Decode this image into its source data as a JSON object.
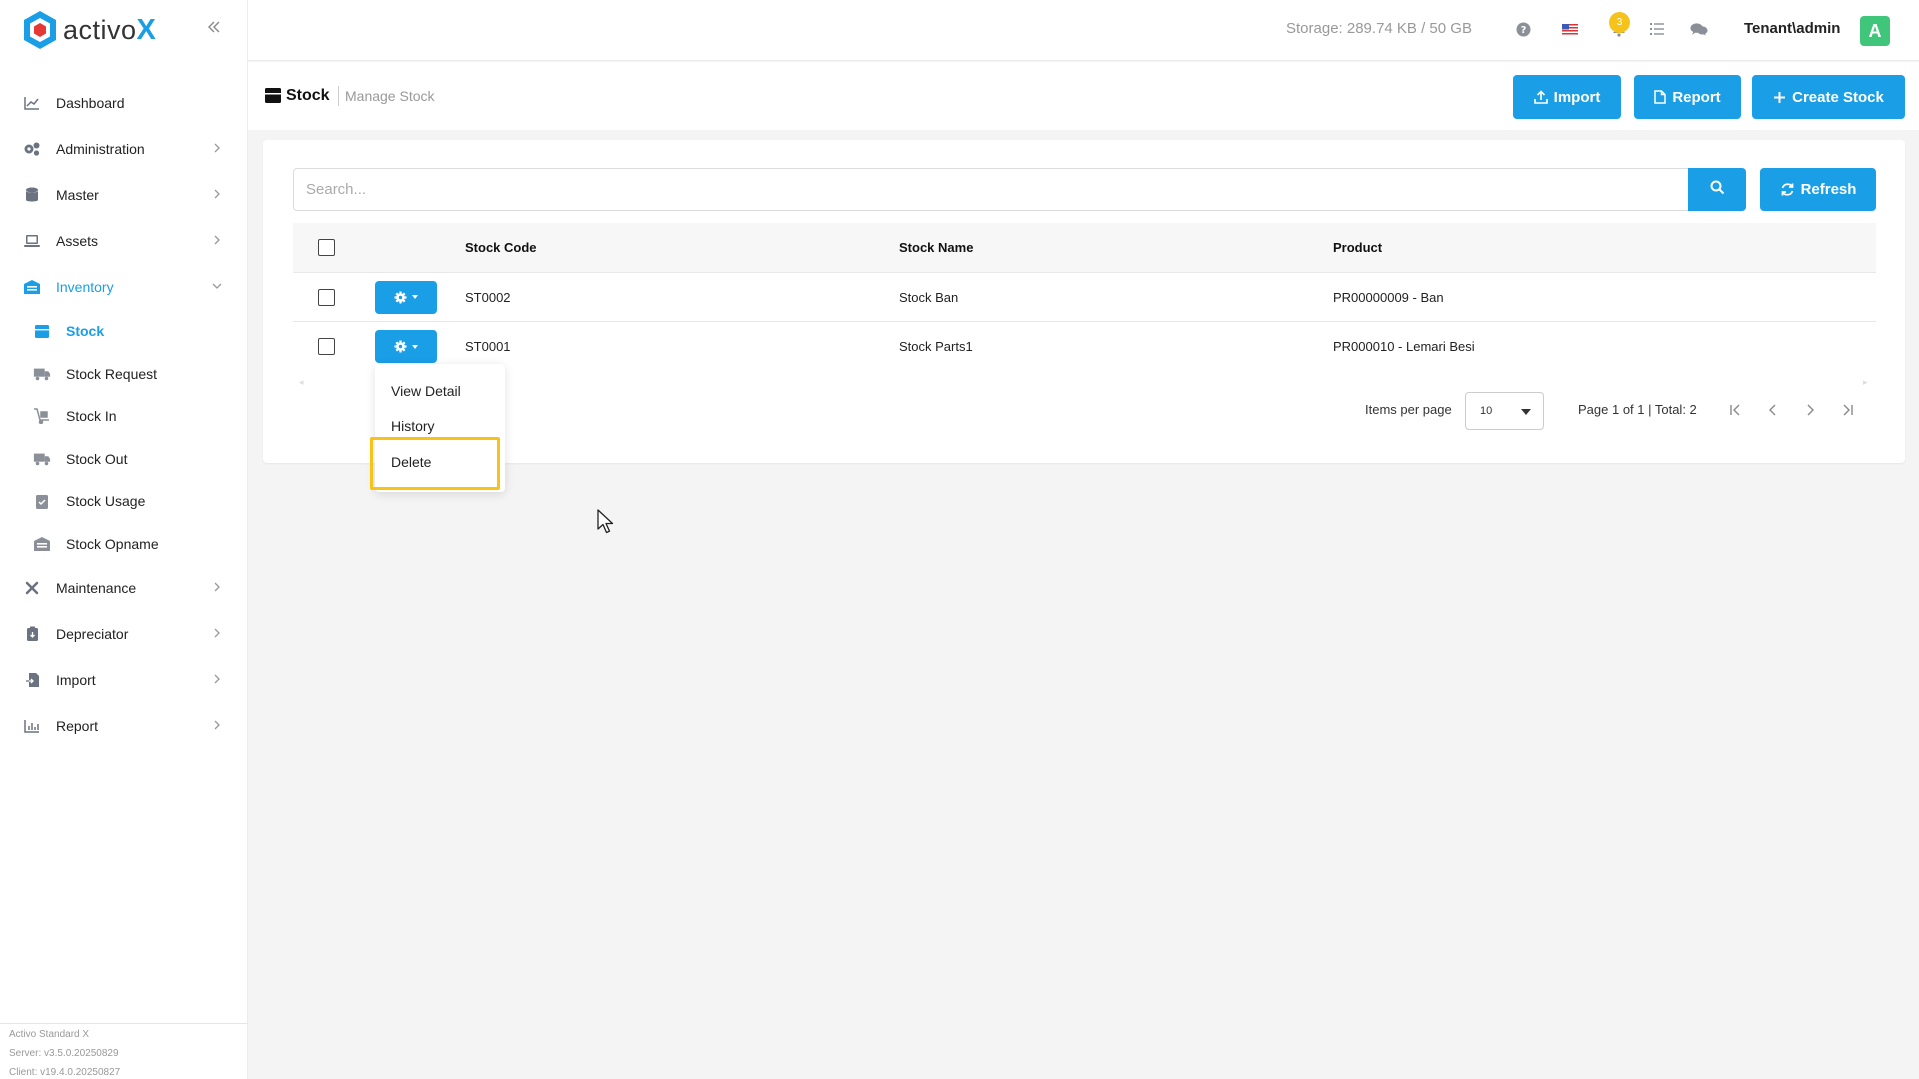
{
  "app": {
    "logo_text": "activo",
    "logo_x": "X"
  },
  "sidebar": {
    "items": [
      {
        "label": "Dashboard",
        "icon": "chart-line-icon",
        "has_chevron": false
      },
      {
        "label": "Administration",
        "icon": "gears-icon",
        "has_chevron": true
      },
      {
        "label": "Master",
        "icon": "database-icon",
        "has_chevron": true
      },
      {
        "label": "Assets",
        "icon": "laptop-icon",
        "has_chevron": true
      },
      {
        "label": "Inventory",
        "icon": "warehouse-icon",
        "has_chevron": true,
        "expanded": true
      }
    ],
    "inventory_sub": [
      {
        "label": "Stock",
        "icon": "box-icon",
        "active": true
      },
      {
        "label": "Stock Request",
        "icon": "truck-icon"
      },
      {
        "label": "Stock In",
        "icon": "dolly-icon"
      },
      {
        "label": "Stock Out",
        "icon": "truck-fast-icon"
      },
      {
        "label": "Stock Usage",
        "icon": "clipboard-check-icon"
      },
      {
        "label": "Stock Opname",
        "icon": "warehouse-icon"
      }
    ],
    "items_after": [
      {
        "label": "Maintenance",
        "icon": "tools-icon"
      },
      {
        "label": "Depreciator",
        "icon": "clipboard-down-icon"
      },
      {
        "label": "Import",
        "icon": "file-import-icon"
      },
      {
        "label": "Report",
        "icon": "chart-bar-icon"
      }
    ],
    "version": {
      "product": "Activo Standard X",
      "server": "Server: v3.5.0.20250829",
      "client": "Client: v19.4.0.20250827"
    }
  },
  "topbar": {
    "storage": "Storage: 289.74 KB / 50 GB",
    "notification_count": "3",
    "user": "Tenant\\admin",
    "avatar_letter": "A"
  },
  "page": {
    "title": "Stock",
    "subtitle": "Manage Stock",
    "buttons": {
      "import": "Import",
      "report": "Report",
      "create": "Create Stock"
    }
  },
  "search": {
    "placeholder": "Search...",
    "refresh": "Refresh"
  },
  "table": {
    "headers": {
      "code": "Stock Code",
      "name": "Stock Name",
      "product": "Product"
    },
    "rows": [
      {
        "code": "ST0002",
        "name": "Stock Ban",
        "product": "PR00000009 - Ban"
      },
      {
        "code": "ST0001",
        "name": "Stock Parts1",
        "product": "PR000010 - Lemari Besi"
      }
    ]
  },
  "pager": {
    "items_per_page_label": "Items per page",
    "items_per_page": "10",
    "info": "Page 1 of 1 | Total: 2"
  },
  "dropdown": {
    "view": "View Detail",
    "history": "History",
    "delete": "Delete"
  },
  "colors": {
    "primary": "#1a9ee6",
    "highlight": "#f6c31a",
    "avatar": "#3fc67a"
  }
}
